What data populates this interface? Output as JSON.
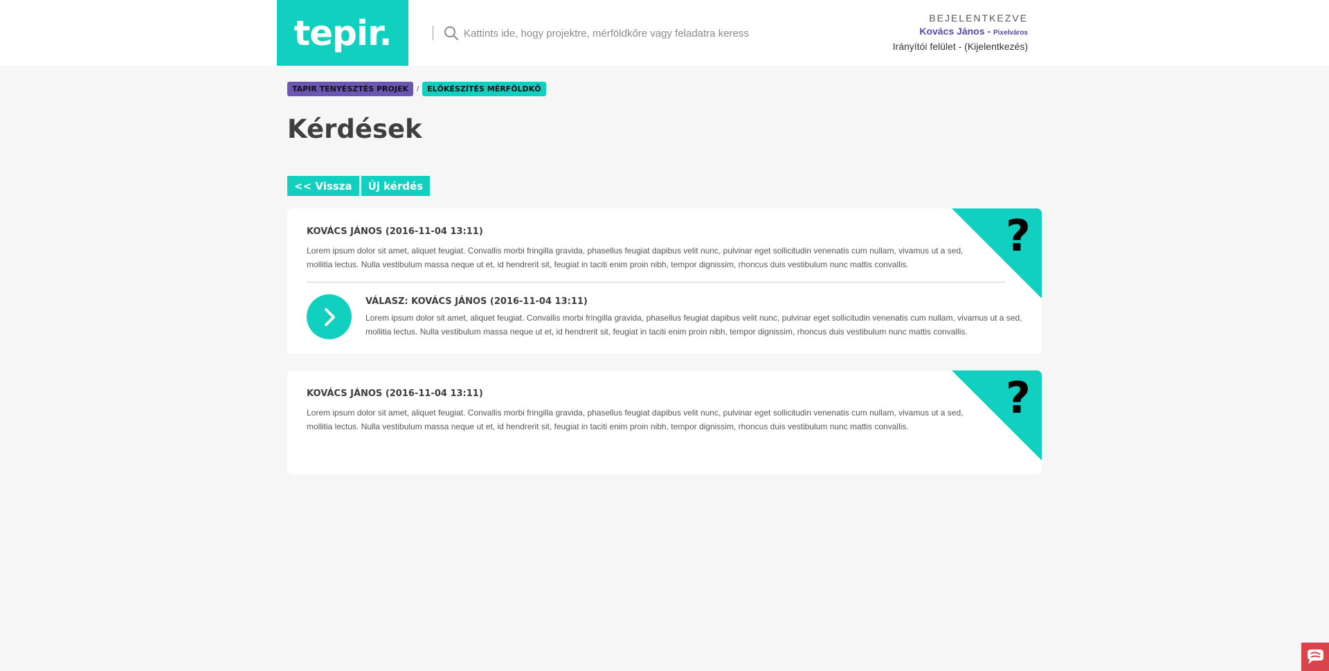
{
  "header": {
    "logo_text": "tepir.",
    "search_placeholder": "Kattints ide, hogy projektre, mérföldkőre vagy feladatra keress",
    "login_status": "BEJELENTKEZVE",
    "user_name": "Kovács János - ",
    "user_city": "Pixelváros",
    "dashboard_link": "Irányítói felület",
    "link_separator": " - ",
    "logout_link": "(Kijelentkezés)"
  },
  "breadcrumb": {
    "project": "TAPIR TENYÉSZTÉS PROJEK",
    "separator": "/",
    "milestone": "ELŐKÉSZÍTÉS MÉRFÖLDKŐ"
  },
  "page_title": "Kérdések",
  "actions": {
    "back_label": "<< Vissza",
    "new_question_label": "Új kérdés"
  },
  "questions": [
    {
      "header": "KOVÁCS JÁNOS (2016-11-04 13:11)",
      "body": "Lorem ipsum dolor sit amet, aliquet feugiat. Convallis morbi fringilla gravida, phasellus feugiat dapibus velit nunc, pulvinar eget sollicitudin venenatis cum nullam, vivamus ut a sed, mollitia lectus. Nulla vestibulum massa neque ut et, id hendrerit sit, feugiat in taciti enim proin nibh, tempor dignissim, rhoncus duis vestibulum nunc mattis convallis.",
      "badge": "?",
      "answer": {
        "header": "VÁLASZ: KOVÁCS JÁNOS (2016-11-04 13:11)",
        "body": "Lorem ipsum dolor sit amet, aliquet feugiat. Convallis morbi fringilla gravida, phasellus feugiat dapibus velit nunc, pulvinar eget sollicitudin venenatis cum nullam, vivamus ut a sed, mollitia lectus. Nulla vestibulum massa neque ut et, id hendrerit sit, feugiat in taciti enim proin nibh, tempor dignissim, rhoncus duis vestibulum nunc mattis convallis."
      }
    },
    {
      "header": "KOVÁCS JÁNOS (2016-11-04 13:11)",
      "body": "Lorem ipsum dolor sit amet, aliquet feugiat. Convallis morbi fringilla gravida, phasellus feugiat dapibus velit nunc, pulvinar eget sollicitudin venenatis cum nullam, vivamus ut a sed, mollitia lectus. Nulla vestibulum massa neque ut et, id hendrerit sit, feugiat in taciti enim proin nibh, tempor dignissim, rhoncus duis vestibulum nunc mattis convallis.",
      "badge": "?"
    }
  ],
  "colors": {
    "accent": "#12d0bf",
    "purple": "#6b56b4",
    "user_name": "#5b47a6",
    "background": "#f6f6f6",
    "help_widget": "#d8434c"
  },
  "icons": {
    "search": "search-icon",
    "answer": "chevron-right-icon",
    "help_widget": "chat-icon"
  }
}
